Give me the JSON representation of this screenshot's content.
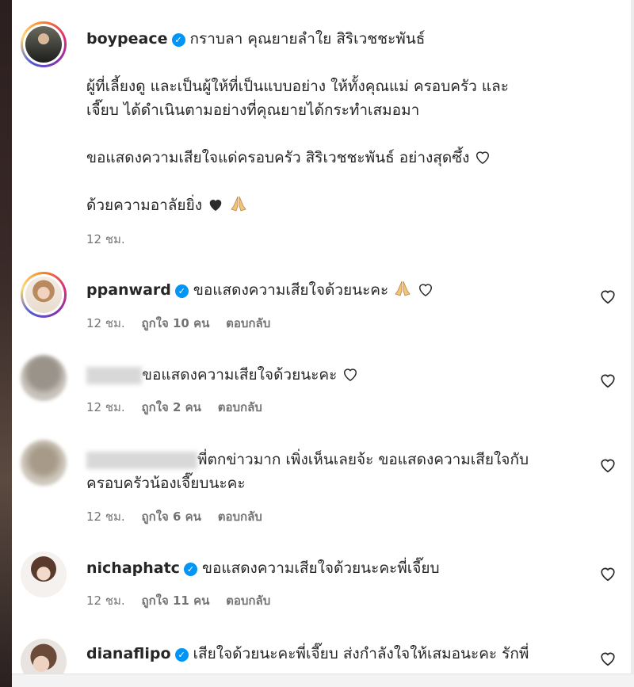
{
  "comments": [
    {
      "username": "boypeace",
      "lines": [
        "กราบลา คุณยายลำใย สิริเวชชะพันธ์",
        "ผู้ที่เลี้ยงดู และเป็นผู้ให้ที่เป็นแบบอย่าง ให้ทั้งคุณแม่ ครอบครัว และ",
        "เจี๊ยบ ได้ดำเนินตามอย่างที่คุณยายได้กระทำเสมอมา",
        "ขอแสดงความเสียใจแด่ครอบครัว สิริเวชชะพันธ์ อย่างสุดซึ้ง",
        "ด้วยความอาลัยยิ่ง"
      ],
      "time": "12 ชม."
    },
    {
      "username": "ppanward",
      "text": "ขอแสดงความเสียใจด้วยนะคะ",
      "time": "12 ชม.",
      "likes": "ถูกใจ 10 คน",
      "reply": "ตอบกลับ"
    },
    {
      "username": "",
      "text": "ขอแสดงความเสียใจด้วยนะคะ",
      "time": "12 ชม.",
      "likes": "ถูกใจ 2 คน",
      "reply": "ตอบกลับ"
    },
    {
      "username": "",
      "text": "พี่ตกข่าวมาก เพิ่งเห็นเลยจ้ะ ขอแสดงความเสียใจกับ",
      "text2": "ครอบครัวน้องเจี๊ยบนะคะ",
      "time": "12 ชม.",
      "likes": "ถูกใจ 6 คน",
      "reply": "ตอบกลับ"
    },
    {
      "username": "nichaphatc",
      "text": "ขอแสดงความเสียใจด้วยนะคะพี่เจี๊ยบ",
      "time": "12 ชม.",
      "likes": "ถูกใจ 11 คน",
      "reply": "ตอบกลับ"
    },
    {
      "username": "dianaflipo",
      "text": "เสียใจด้วยนะคะพี่เจี๊ยบ ส่งกำลังใจให้เสมอนะคะ รักพี่"
    }
  ],
  "icons": {
    "heart": "heart-outline-icon",
    "verified": "verified-badge-icon",
    "pray": "folded-hands-emoji",
    "black_heart": "black-heart-emoji"
  },
  "colors": {
    "verified": "#0095f6",
    "meta": "#737373",
    "text": "#262626"
  },
  "glyphs": {
    "check": "✓"
  }
}
